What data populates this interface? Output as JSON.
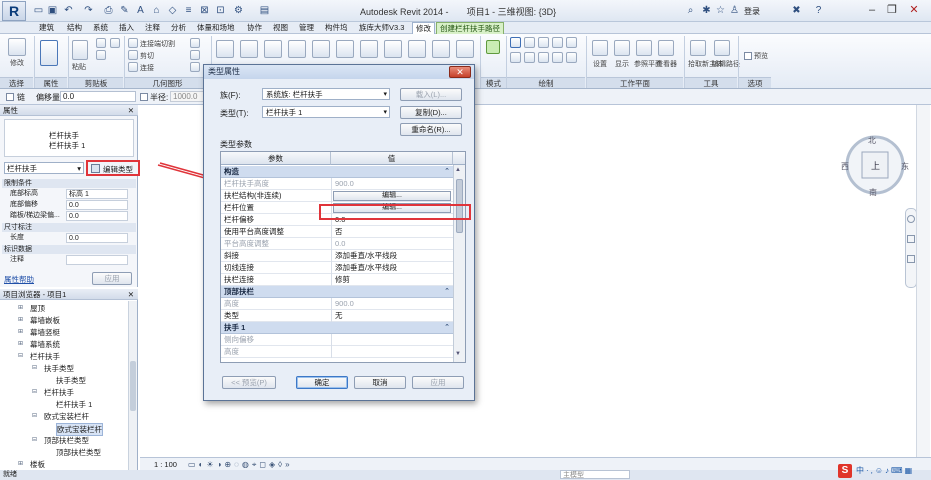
{
  "app": {
    "logo": "R",
    "title": "Autodesk Revit 2014 -",
    "project": "项目1 - 三维视图: {3D}",
    "login_label": "登录"
  },
  "tabs": [
    "建筑",
    "结构",
    "系统",
    "插入",
    "注释",
    "分析",
    "体量和场地",
    "协作",
    "视图",
    "管理",
    "构件坞",
    "族库大师V3.3",
    "修改",
    "创建栏杆扶手路径"
  ],
  "ribbon_panels": [
    "选择",
    "属性",
    "剪贴板",
    "几何图形",
    "模式",
    "绘制",
    "工作平面",
    "工具",
    "选项"
  ],
  "ribbon_texts": {
    "modify": "修改",
    "paste": "粘贴",
    "cut": "连接端切割",
    "join": "连接",
    "settings": "设置",
    "show": "显示",
    "ref_plane": "参照平面",
    "viewer": "查看器",
    "pick_host": "拾取新主体",
    "edit_path": "编辑路径",
    "preview": "预览"
  },
  "options_bar": {
    "chain_label": "链",
    "offset_label": "偏移量:",
    "offset_value": "0.0",
    "radius_label": "半径:",
    "radius_value": "1000.0"
  },
  "properties": {
    "header": "属性",
    "type_name_1": "栏杆扶手",
    "type_name_2": "栏杆扶手 1",
    "selector": "栏杆扶手",
    "edit_type": "编辑类型",
    "groups": [
      {
        "label": "限制条件",
        "rows": [
          {
            "k": "底部标高",
            "v": "标高 1"
          },
          {
            "k": "底部偏移",
            "v": "0.0"
          },
          {
            "k": "踏板/梯边梁偏...",
            "v": "0.0"
          }
        ]
      },
      {
        "label": "尺寸标注",
        "rows": [
          {
            "k": "长度",
            "v": "0.0"
          }
        ]
      },
      {
        "label": "标识数据",
        "rows": [
          {
            "k": "注释",
            "v": ""
          }
        ]
      }
    ],
    "help": "属性帮助",
    "apply": "应用"
  },
  "browser": {
    "header": "项目浏览器 - 项目1",
    "items": [
      {
        "label": "屋顶",
        "level": 1
      },
      {
        "label": "幕墙嵌板",
        "level": 1
      },
      {
        "label": "幕墙竖梃",
        "level": 1
      },
      {
        "label": "幕墙系统",
        "level": 1
      },
      {
        "label": "栏杆扶手",
        "level": 1
      },
      {
        "label": "扶手类型",
        "level": 2
      },
      {
        "label": "扶手类型",
        "level": 3
      },
      {
        "label": "栏杆扶手",
        "level": 2
      },
      {
        "label": "栏杆扶手 1",
        "level": 3
      },
      {
        "label": "欧式宝装栏杆",
        "level": 2
      },
      {
        "label": "欧式宝装栏杆",
        "level": 3
      },
      {
        "label": "顶部扶栏类型",
        "level": 2
      },
      {
        "label": "顶部扶栏类型",
        "level": 3
      },
      {
        "label": "楼板",
        "level": 1
      }
    ]
  },
  "viewbar": {
    "scale": "1 : 100"
  },
  "status": {
    "text": "就绪",
    "main_model": "主模型"
  },
  "viewcube": {
    "north": "北",
    "west": "西",
    "east": "东",
    "south": "南",
    "face": "上"
  },
  "dialog": {
    "title": "类型属性",
    "family_label": "族(F):",
    "family_value": "系统族: 栏杆扶手",
    "type_label": "类型(T):",
    "type_value": "栏杆扶手 1",
    "load_btn": "载入(L)...",
    "duplicate_btn": "复制(D)...",
    "rename_btn": "重命名(R)...",
    "params_label": "类型参数",
    "col_param": "参数",
    "col_value": "值",
    "sections": [
      {
        "label": "构造",
        "rows": [
          {
            "p": "栏杆扶手高度",
            "v": "900.0",
            "dim": true
          },
          {
            "p": "扶栏结构(非连续)",
            "v": "编辑...",
            "button": true
          },
          {
            "p": "栏杆位置",
            "v": "编辑...",
            "button": true
          },
          {
            "p": "栏杆偏移",
            "v": "0.0"
          },
          {
            "p": "使用平台高度调整",
            "v": "否"
          },
          {
            "p": "平台高度调整",
            "v": "0.0",
            "dim": true
          },
          {
            "p": "斜接",
            "v": "添加垂直/水平线段"
          },
          {
            "p": "切线连接",
            "v": "添加垂直/水平线段"
          },
          {
            "p": "扶栏连接",
            "v": "修剪"
          }
        ]
      },
      {
        "label": "顶部扶栏",
        "rows": [
          {
            "p": "高度",
            "v": "900.0",
            "dim": true
          },
          {
            "p": "类型",
            "v": "无"
          }
        ]
      },
      {
        "label": "扶手 1",
        "rows": [
          {
            "p": "侧向偏移",
            "v": "",
            "dim": true
          },
          {
            "p": "高度",
            "v": "",
            "dim": true
          }
        ]
      }
    ],
    "preview_btn": "<< 预览(P)",
    "ok_btn": "确定",
    "cancel_btn": "取消",
    "apply_btn": "应用"
  },
  "colors": {
    "annotation": "#e0343a",
    "ribbon_context": "#d8f0c8"
  }
}
